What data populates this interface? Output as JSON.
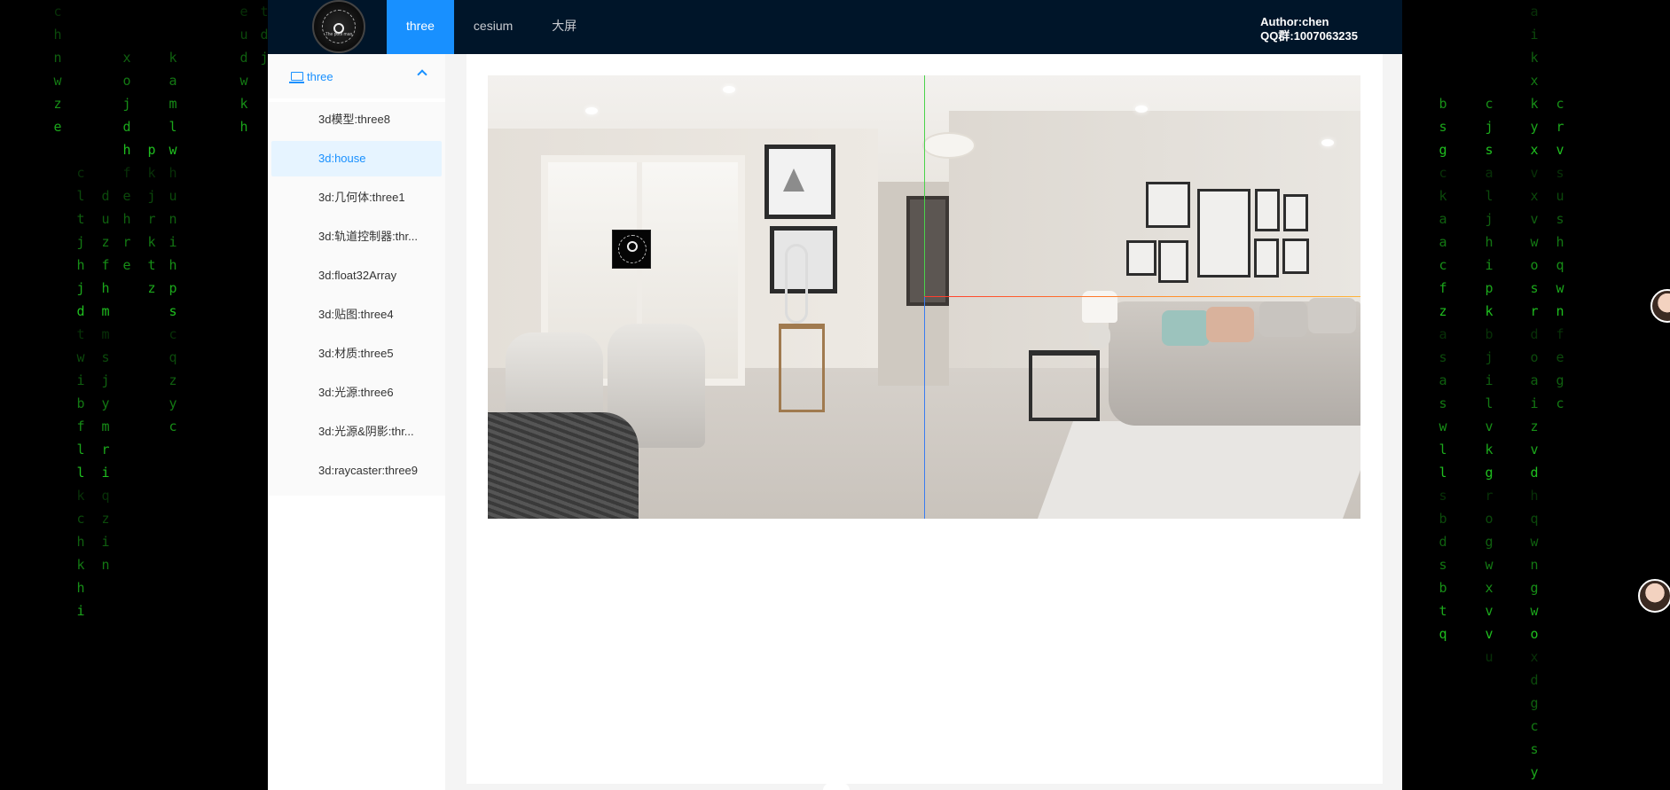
{
  "header": {
    "logo_icon": "circular-brand-logo",
    "logo_text": "The pool man",
    "nav": [
      "three",
      "cesium",
      "大屏"
    ],
    "active_nav": "three",
    "author_line1": "Author:chen",
    "author_line2": "QQ群:1007063235"
  },
  "sidebar": {
    "group_title": "three",
    "group_icon": "laptop-icon",
    "expanded": true,
    "items": [
      "3d模型:three8",
      "3d:house",
      "3d:几何体:three1",
      "3d:轨道控制器:thr...",
      "3d:float32Array",
      "3d:贴图:three4",
      "3d:材质:three5",
      "3d:光源:three6",
      "3d:光源&阴影:thr...",
      "3d:raycaster:three9"
    ],
    "selected": "3d:house"
  },
  "scene": {
    "description_icon": "panorama-living-room",
    "axes_colors": {
      "x": "#ff5a2a",
      "y": "#4bd34b",
      "z": "#3a7cf0"
    }
  },
  "matrix_rain": {
    "color": "#1fbf1f",
    "columns_left": [
      "chnwze",
      "  xojdhfehre",
      "  kamlwhunihpscqzyc",
      "eudwkh",
      "tdj",
      "        duzfhmmsjymriqzin",
      "       cltjhjdtwibfllkchkhi",
      "      pkjrktz"
    ],
    "columns_right": [
      "aikxkyxvxvwosrdoaizvdhqwngwoxdgcsy",
      "    bsgckaacfzasaswllsbdsbtq",
      "    cjsaljhipkbjilvkgrogwxvvu",
      "    crvsushqwnfegc"
    ]
  }
}
